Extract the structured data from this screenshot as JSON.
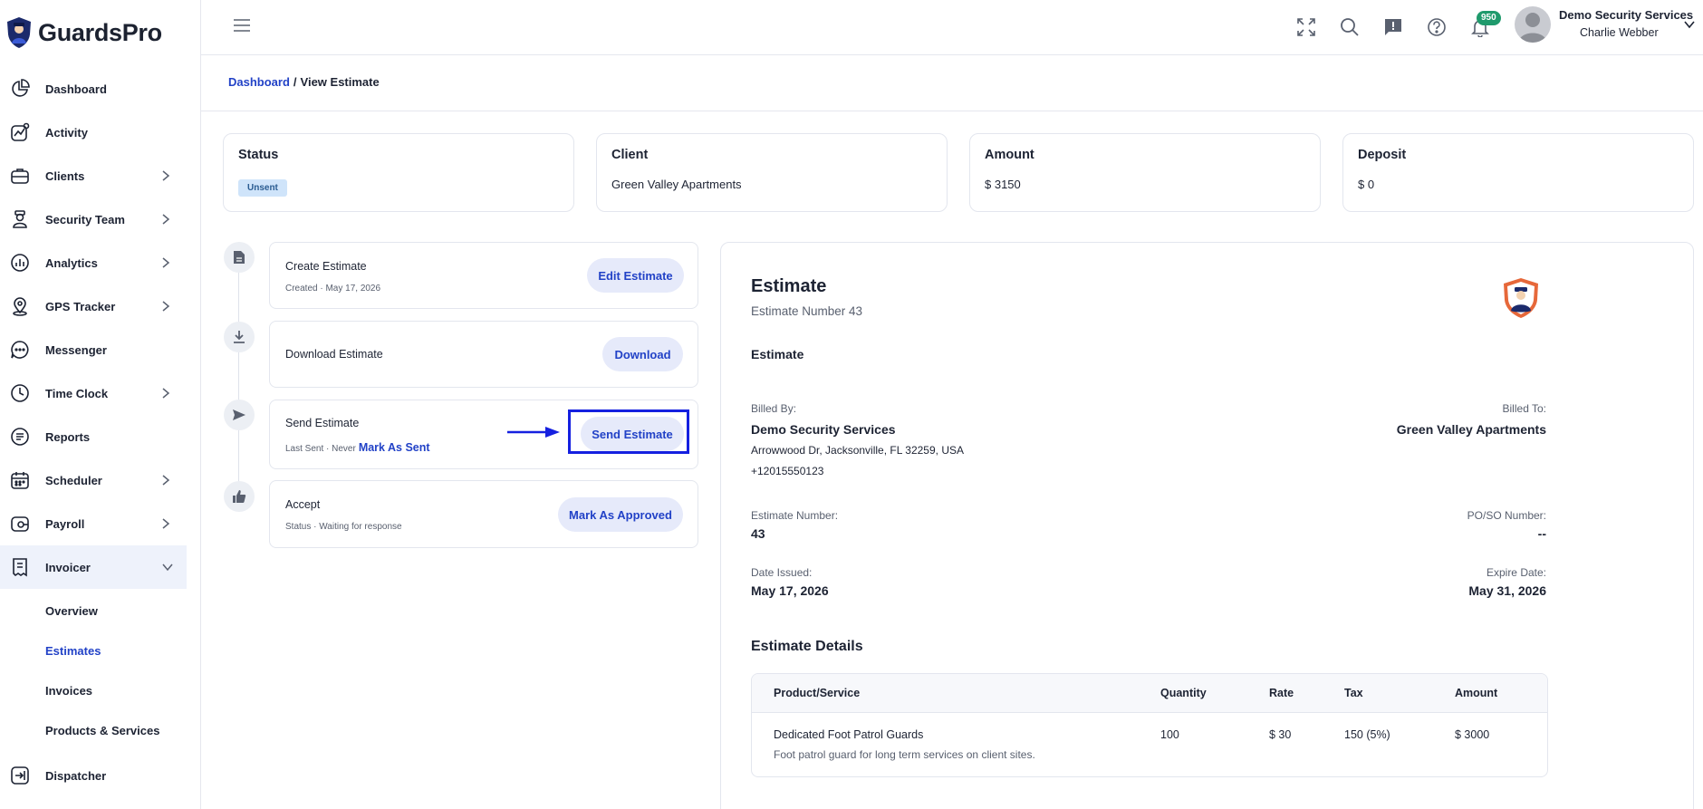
{
  "brand": {
    "name": "GuardsPro"
  },
  "sidebar": {
    "items": [
      {
        "label": "Dashboard",
        "icon": "pie-chart-icon",
        "expandable": false
      },
      {
        "label": "Activity",
        "icon": "activity-icon",
        "expandable": false
      },
      {
        "label": "Clients",
        "icon": "briefcase-icon",
        "expandable": true
      },
      {
        "label": "Security Team",
        "icon": "guard-icon",
        "expandable": true
      },
      {
        "label": "Analytics",
        "icon": "bar-chart-icon",
        "expandable": true
      },
      {
        "label": "GPS Tracker",
        "icon": "location-pin-icon",
        "expandable": true
      },
      {
        "label": "Messenger",
        "icon": "chat-bubble-icon",
        "expandable": false
      },
      {
        "label": "Time Clock",
        "icon": "clock-icon",
        "expandable": true
      },
      {
        "label": "Reports",
        "icon": "report-icon",
        "expandable": false
      },
      {
        "label": "Scheduler",
        "icon": "calendar-icon",
        "expandable": true
      },
      {
        "label": "Payroll",
        "icon": "wallet-icon",
        "expandable": true
      },
      {
        "label": "Invoicer",
        "icon": "invoice-icon",
        "expandable": true,
        "expanded": true
      }
    ],
    "invoicer_sub": [
      "Overview",
      "Estimates",
      "Invoices",
      "Products & Services"
    ],
    "active_sub": "Estimates",
    "bottom_item": {
      "label": "Dispatcher",
      "icon": "dispatch-icon"
    }
  },
  "header": {
    "notification_count": "950",
    "company": "Demo Security Services",
    "user": "Charlie Webber"
  },
  "breadcrumb": {
    "root": "Dashboard",
    "separator": "/",
    "current": "View Estimate"
  },
  "summary": {
    "status": {
      "title": "Status",
      "value": "Unsent"
    },
    "client": {
      "title": "Client",
      "value": "Green Valley Apartments"
    },
    "amount": {
      "title": "Amount",
      "value": "$ 3150"
    },
    "deposit": {
      "title": "Deposit",
      "value": "$ 0"
    }
  },
  "steps": {
    "create": {
      "title": "Create Estimate",
      "sub": "Created · May 17, 2026",
      "button": "Edit Estimate"
    },
    "download": {
      "title": "Download Estimate",
      "button": "Download"
    },
    "send": {
      "title": "Send Estimate",
      "sub": "Last Sent · Never",
      "link": "Mark As Sent",
      "button": "Send Estimate"
    },
    "accept": {
      "title": "Accept",
      "sub": "Status · Waiting for response",
      "button": "Mark As Approved"
    }
  },
  "estimate": {
    "title": "Estimate",
    "number_line": "Estimate Number 43",
    "subtitle": "Estimate",
    "billed_by_label": "Billed By:",
    "billed_by_name": "Demo Security Services",
    "billed_by_address": "Arrowwood Dr, Jacksonville, FL 32259, USA",
    "billed_by_phone": "+12015550123",
    "billed_to_label": "Billed To:",
    "billed_to_name": "Green Valley Apartments",
    "number_label": "Estimate Number:",
    "number_value": "43",
    "po_label": "PO/SO Number:",
    "po_value": "--",
    "issued_label": "Date Issued:",
    "issued_value": "May 17, 2026",
    "expire_label": "Expire Date:",
    "expire_value": "May 31, 2026",
    "details_title": "Estimate Details",
    "columns": [
      "Product/Service",
      "Quantity",
      "Rate",
      "Tax",
      "Amount"
    ],
    "rows": [
      {
        "product": "Dedicated Foot Patrol Guards",
        "description": "Foot patrol guard for long term services on client sites.",
        "quantity": "100",
        "rate": "$ 30",
        "tax": "150 (5%)",
        "amount": "$ 3000"
      }
    ]
  },
  "colors": {
    "accent": "#2242c7",
    "badge": "#1f9a6c",
    "highlight": "#1520e0"
  }
}
